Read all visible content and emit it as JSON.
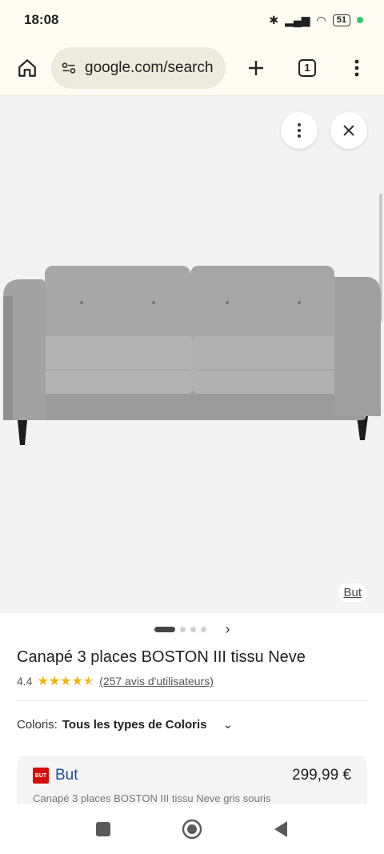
{
  "status": {
    "time": "18:08",
    "battery": "51"
  },
  "toolbar": {
    "url": "google.com/search",
    "tab_count": "1"
  },
  "image": {
    "source": "But"
  },
  "product": {
    "title": "Canapé 3 places BOSTON III tissu Neve",
    "rating": "4.4",
    "stars": 4.4,
    "reviews": "(257 avis d'utilisateurs)"
  },
  "filter": {
    "label": "Coloris:",
    "value": "Tous les types de Coloris"
  },
  "offer": {
    "merchant": "But",
    "merchant_logo": "BUT",
    "price": "299,99 €",
    "description": "Canapé 3 places BOSTON III tissu Neve gris souris"
  },
  "colors": {
    "accent": "#1a4fa0",
    "star": "#f3b300",
    "logo": "#d40b0b"
  }
}
